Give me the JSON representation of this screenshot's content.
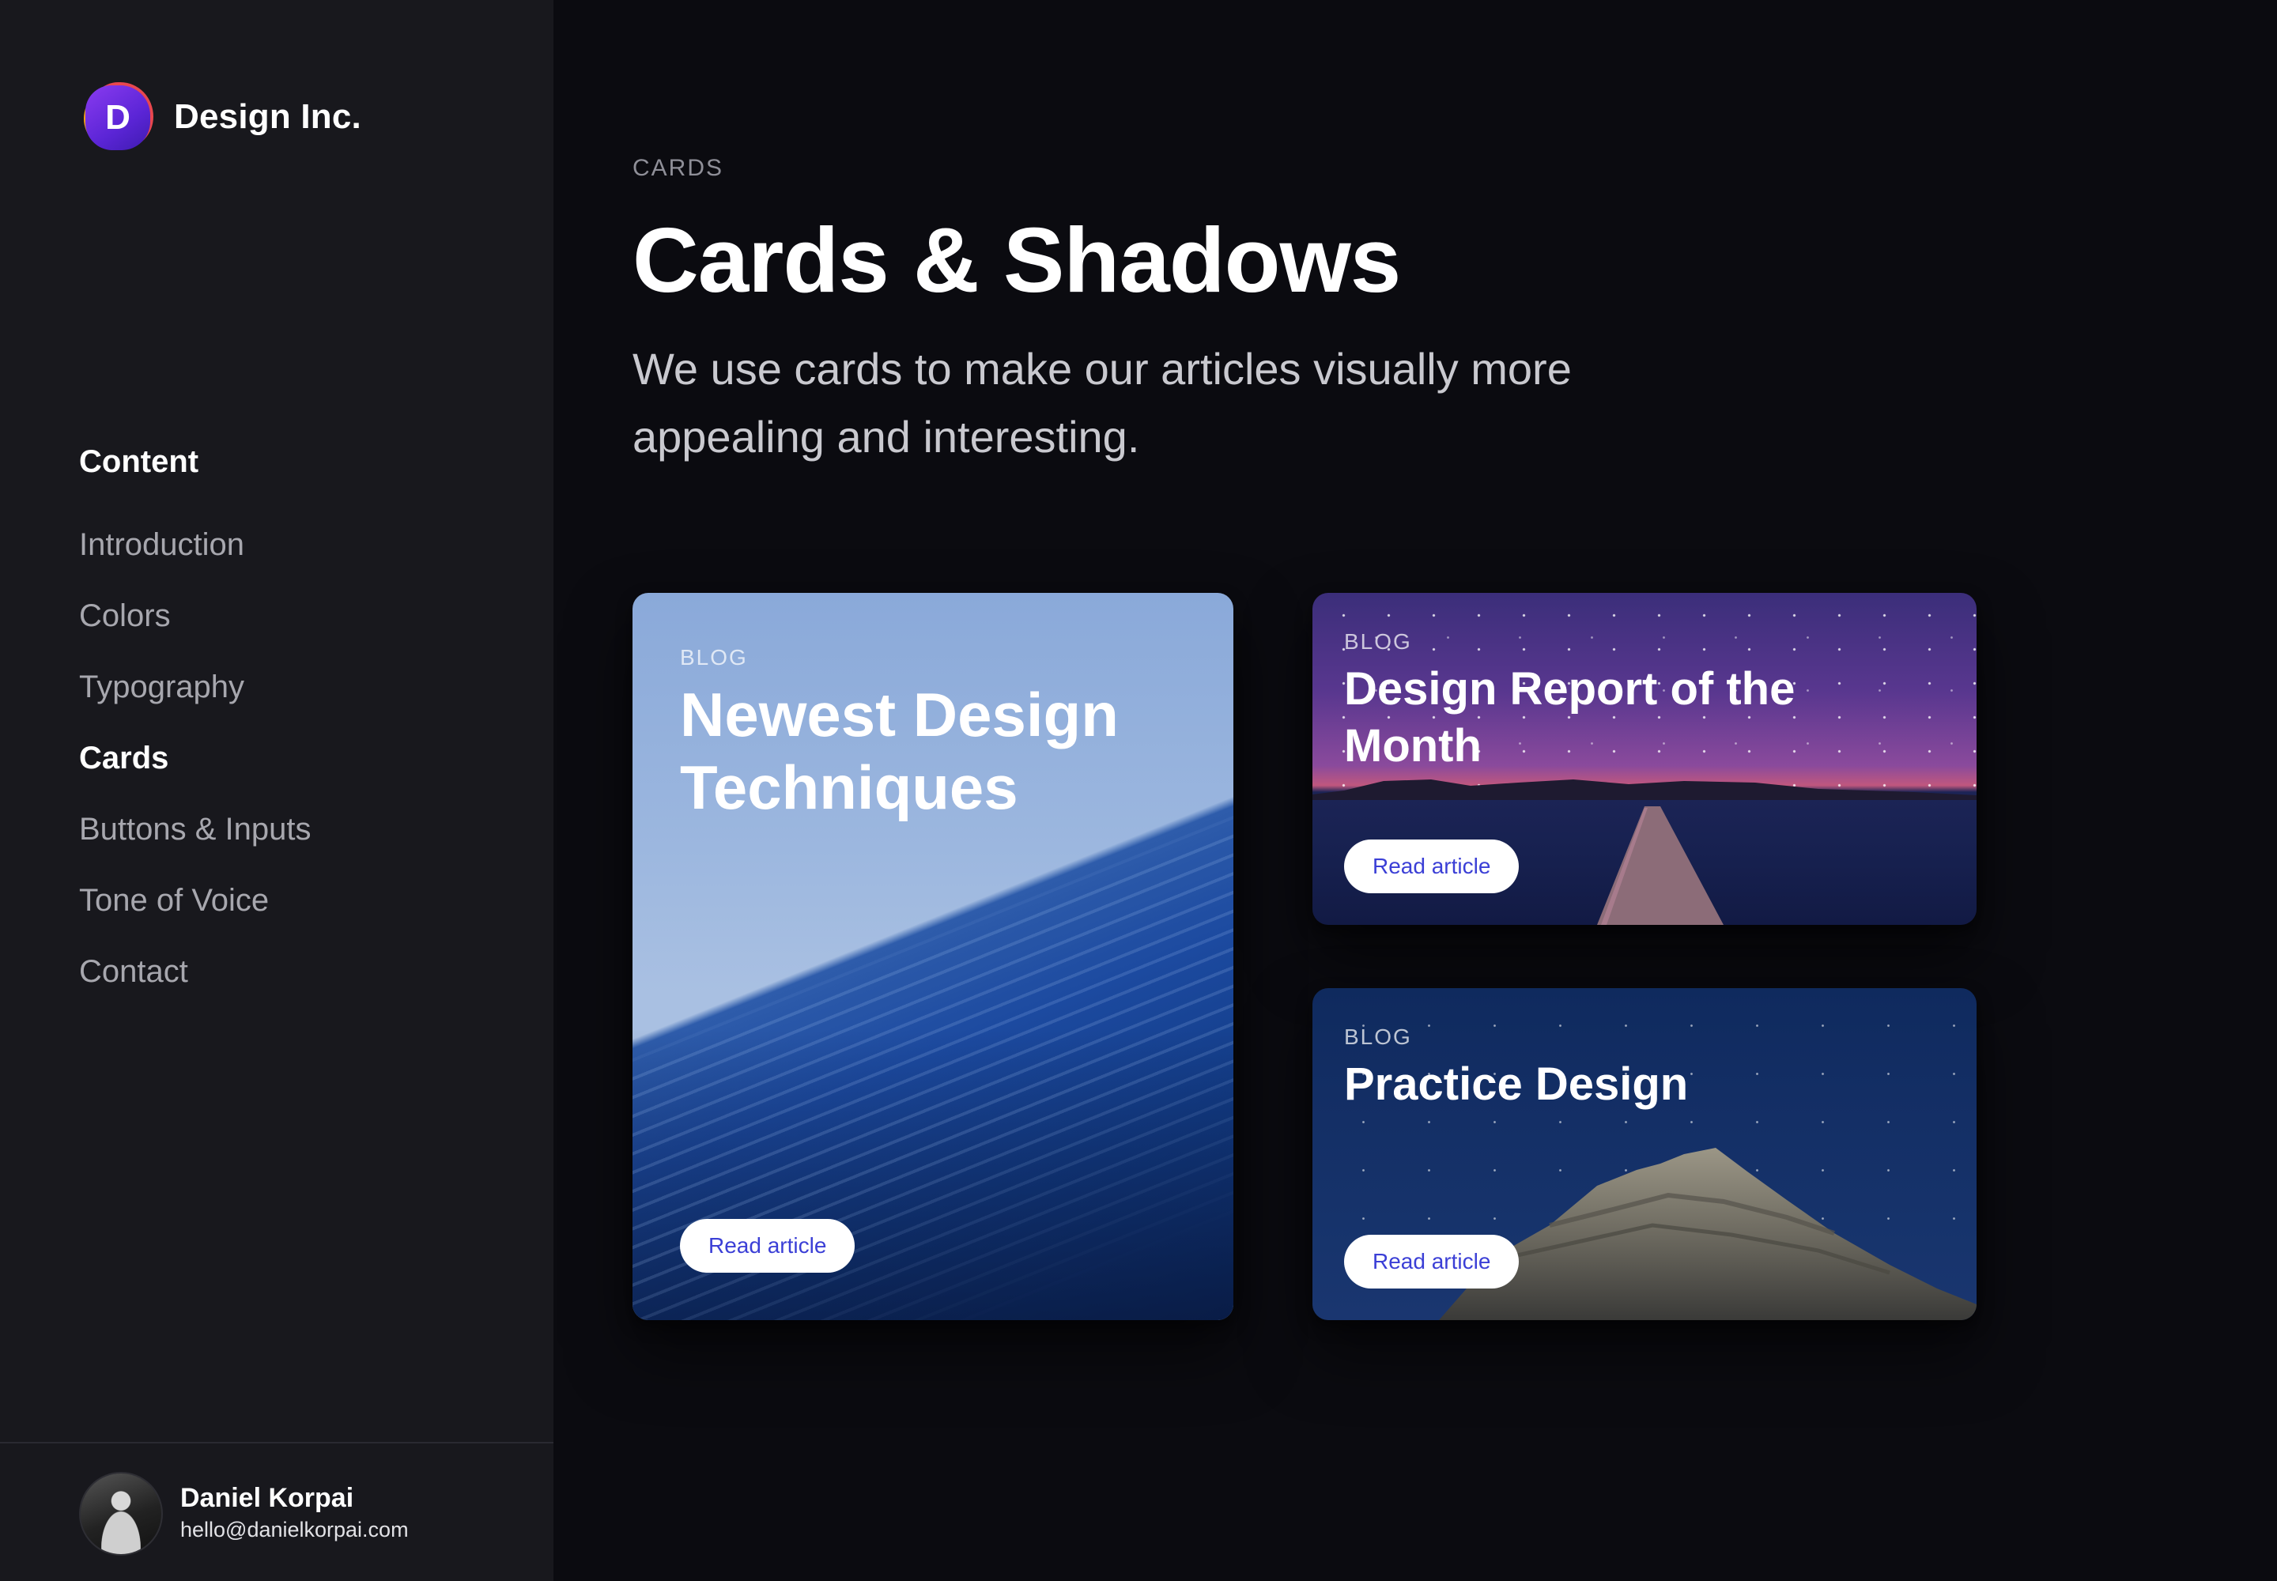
{
  "brand": {
    "logo_letter": "D",
    "name": "Design Inc."
  },
  "sidebar": {
    "heading": "Content",
    "items": [
      {
        "label": "Introduction",
        "active": false
      },
      {
        "label": "Colors",
        "active": false
      },
      {
        "label": "Typography",
        "active": false
      },
      {
        "label": "Cards",
        "active": true
      },
      {
        "label": "Buttons & Inputs",
        "active": false
      },
      {
        "label": "Tone of Voice",
        "active": false
      },
      {
        "label": "Contact",
        "active": false
      }
    ]
  },
  "profile": {
    "name": "Daniel Korpai",
    "email": "hello@danielkorpai.com"
  },
  "main": {
    "eyebrow": "CARDS",
    "title": "Cards & Shadows",
    "lead": "We use cards to make our articles visually more appealing and interesting."
  },
  "cards": [
    {
      "eyebrow": "BLOG",
      "title": "Newest Design Techniques",
      "button": "Read article",
      "image": "ocean-wave"
    },
    {
      "eyebrow": "BLOG",
      "title": "Design Report of the Month",
      "button": "Read article",
      "image": "night-pier"
    },
    {
      "eyebrow": "BLOG",
      "title": "Practice Design",
      "button": "Read article",
      "image": "night-mountain"
    }
  ],
  "colors": {
    "sidebar_bg": "#18181d",
    "main_bg": "#0b0b10",
    "button_text": "#3b3fd6",
    "logo_purple": "#5b25d6",
    "logo_orange": "#f6a21c",
    "logo_red": "#e8474f"
  }
}
